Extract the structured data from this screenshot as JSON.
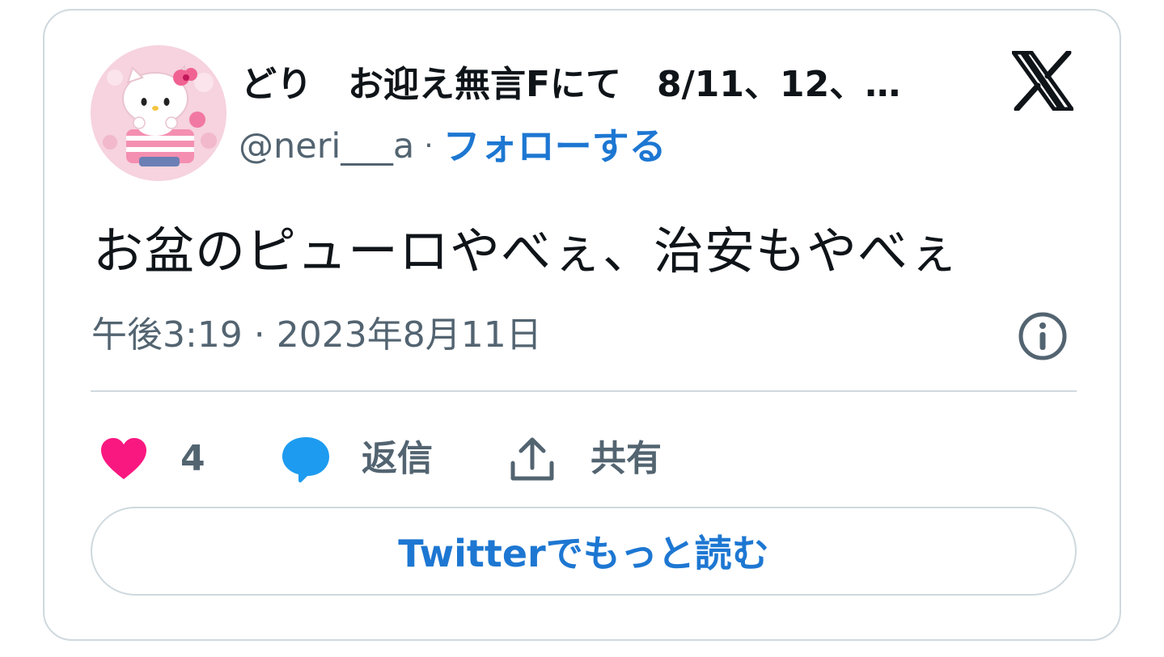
{
  "author": {
    "display_name": "どり　お迎え無言Fにて　8/11、12、…",
    "handle": "@neri___a",
    "separator": "·",
    "follow_label": "フォローする"
  },
  "tweet": {
    "text": "お盆のピューロやべぇ、治安もやべぇ",
    "timestamp": "午後3:19 · 2023年8月11日"
  },
  "actions": {
    "like_count": "4",
    "reply_label": "返信",
    "share_label": "共有"
  },
  "read_more_label": "Twitterでもっと読む",
  "icons": {
    "brand": "x-logo-icon",
    "info": "info-icon",
    "like": "heart-icon",
    "reply": "speech-bubble-icon",
    "share": "share-upload-icon"
  },
  "colors": {
    "accent_blue": "#1d77d2",
    "like_pink": "#f91880",
    "reply_blue": "#1d9bf0",
    "muted_gray": "#536471",
    "border": "#cfd9de",
    "text": "#0f1419"
  }
}
